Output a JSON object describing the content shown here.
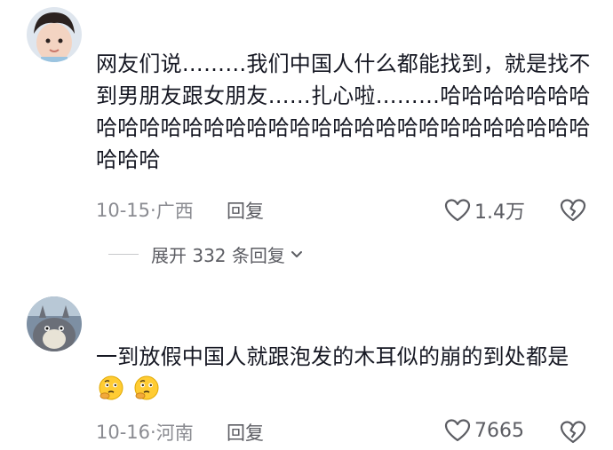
{
  "comments": [
    {
      "text": "网友们说………我们中国人什么都能找到，就是找不到男朋友跟女朋友……扎心啦………哈哈哈哈哈哈哈哈哈哈哈哈哈哈哈哈哈哈哈哈哈哈哈哈哈哈哈哈哈哈哈哈哈",
      "date": "10-15",
      "region": "广西",
      "reply_label": "回复",
      "likes": "1.4万",
      "replies_expand": "展开 332 条回复"
    },
    {
      "text": "一到放假中国人就跟泡发的木耳似的崩的到处都是",
      "date": "10-16",
      "region": "河南",
      "reply_label": "回复",
      "likes": "7665"
    }
  ],
  "icons": {
    "like": "heart-outline-icon",
    "dislike": "broken-heart-icon",
    "expand": "chevron-down-icon",
    "emoji": "thinking-face-icon"
  },
  "colors": {
    "text": "#161823",
    "meta": "#8a8b91",
    "action": "#5c5d63"
  }
}
